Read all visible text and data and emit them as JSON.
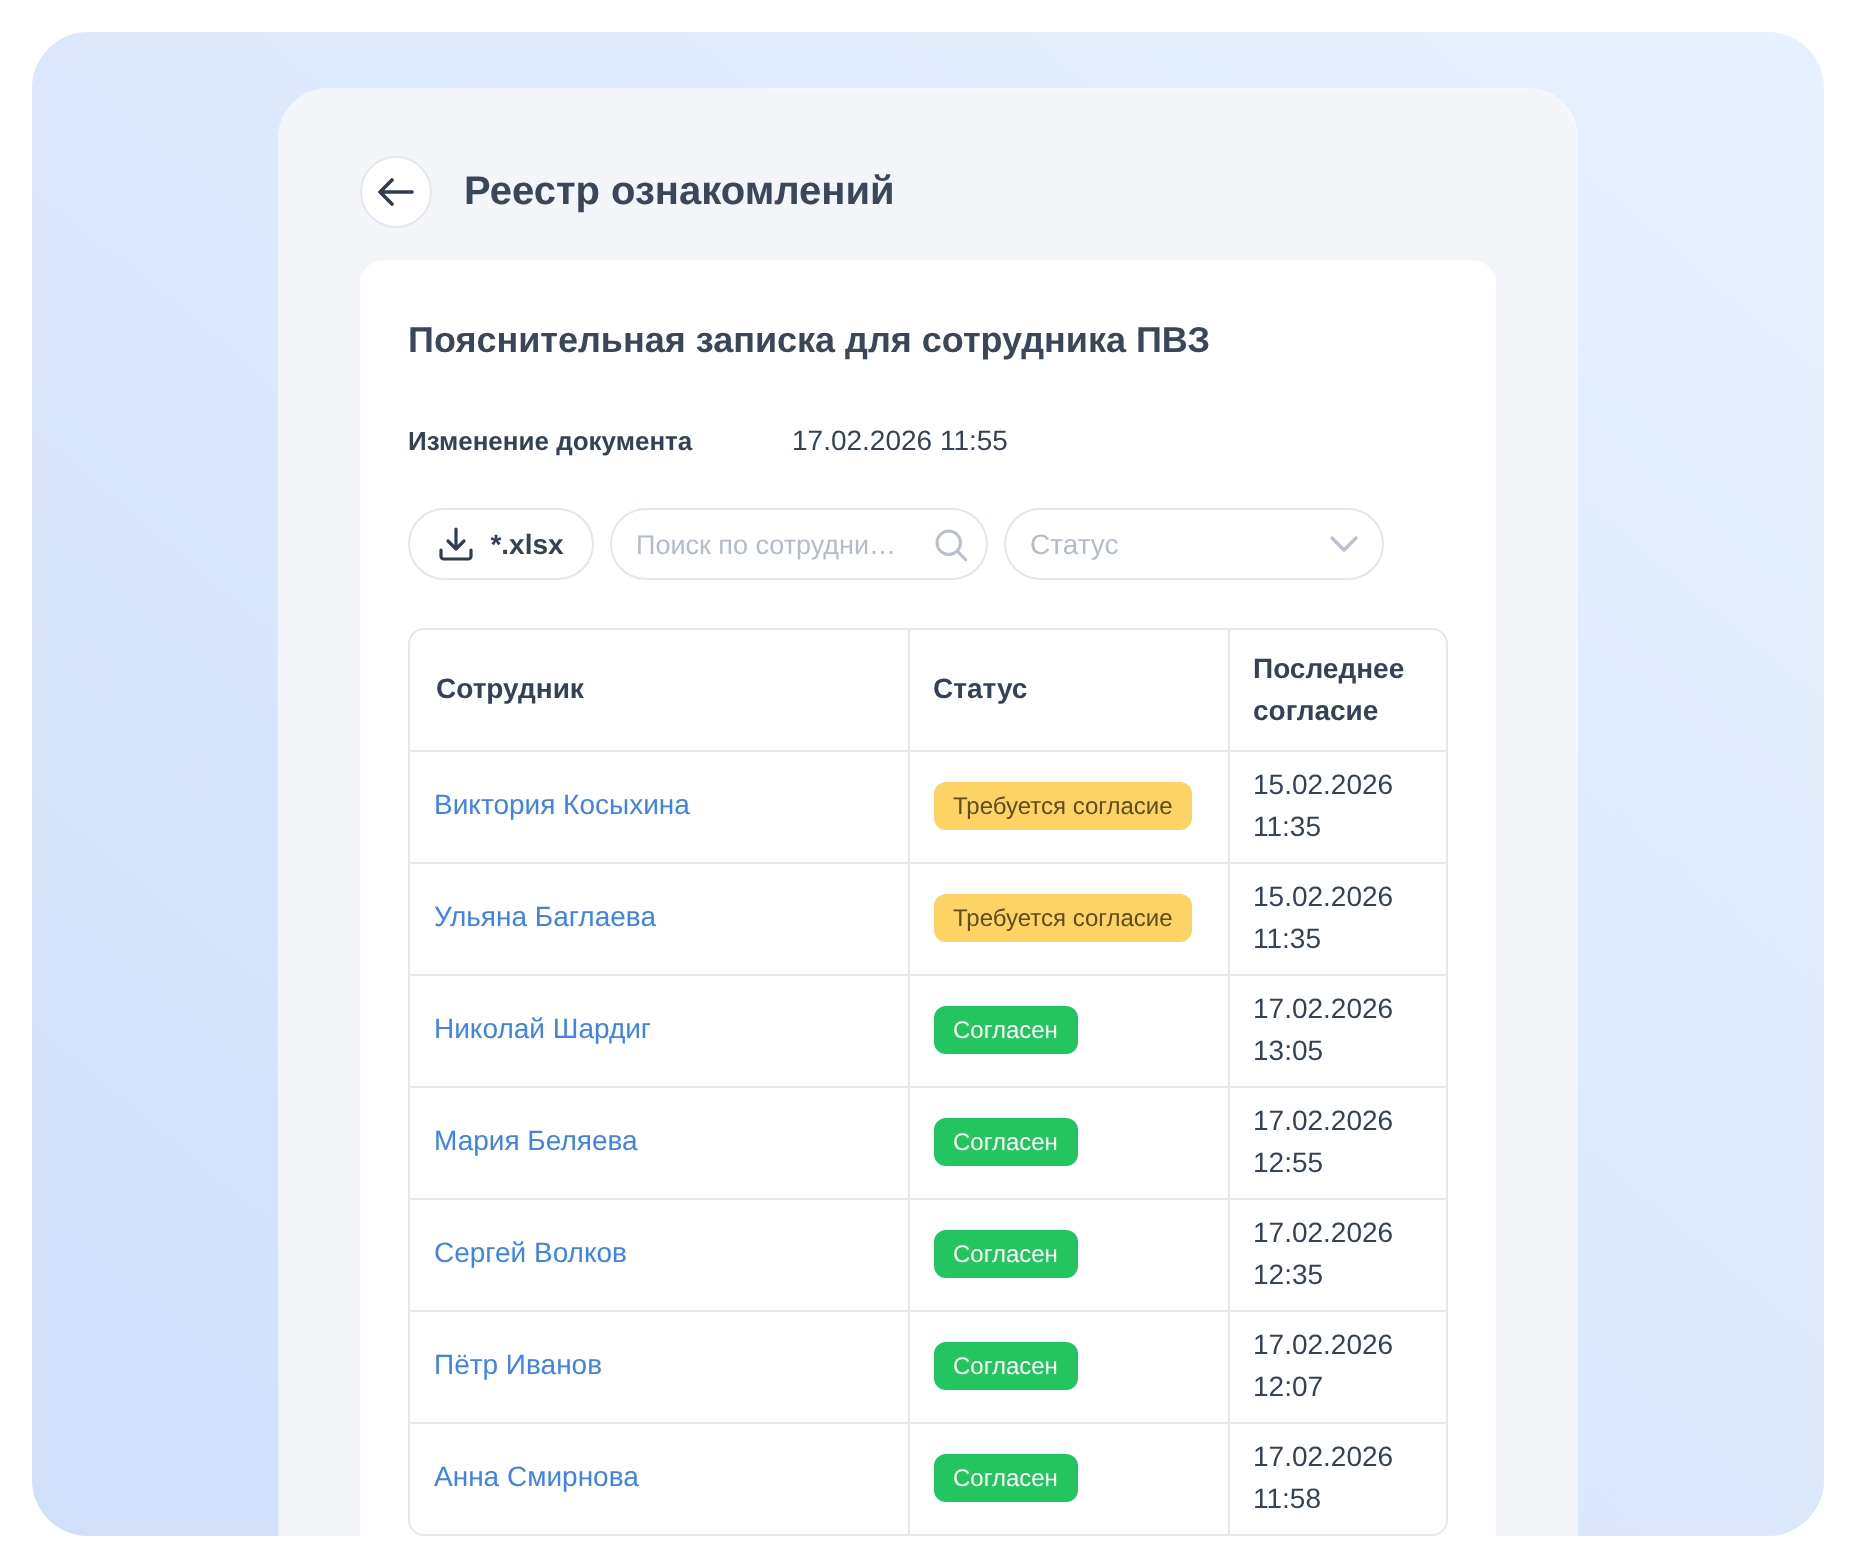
{
  "page": {
    "title": "Реестр ознакомлений"
  },
  "document": {
    "title": "Пояснительная записка для сотрудника ПВЗ",
    "meta": [
      {
        "label": "Изменение документа",
        "value": "17.02.2026 11:55"
      }
    ]
  },
  "toolbar": {
    "export_button": "*.xlsx",
    "search": {
      "placeholder": "Поиск по сотрудни…"
    },
    "status_filter": {
      "placeholder": "Статус"
    }
  },
  "table": {
    "columns": [
      "Сотрудник",
      "Статус",
      "Последнее согласие"
    ],
    "rows": [
      {
        "employee": "Виктория Косыхина",
        "status": {
          "label": "Требуется согласие",
          "kind": "pending"
        },
        "last_consent": "15.02.2026 11:35"
      },
      {
        "employee": "Ульяна Баглаева",
        "status": {
          "label": "Требуется согласие",
          "kind": "pending"
        },
        "last_consent": "15.02.2026 11:35"
      },
      {
        "employee": "Николай Шардиг",
        "status": {
          "label": "Согласен",
          "kind": "agreed"
        },
        "last_consent": "17.02.2026 13:05"
      },
      {
        "employee": "Мария Беляева",
        "status": {
          "label": "Согласен",
          "kind": "agreed"
        },
        "last_consent": "17.02.2026 12:55"
      },
      {
        "employee": "Сергей Волков",
        "status": {
          "label": "Согласен",
          "kind": "agreed"
        },
        "last_consent": "17.02.2026 12:35"
      },
      {
        "employee": "Пётр Иванов",
        "status": {
          "label": "Согласен",
          "kind": "agreed"
        },
        "last_consent": "17.02.2026 12:07"
      },
      {
        "employee": "Анна Смирнова",
        "status": {
          "label": "Согласен",
          "kind": "agreed"
        },
        "last_consent": "17.02.2026 11:58"
      }
    ]
  }
}
